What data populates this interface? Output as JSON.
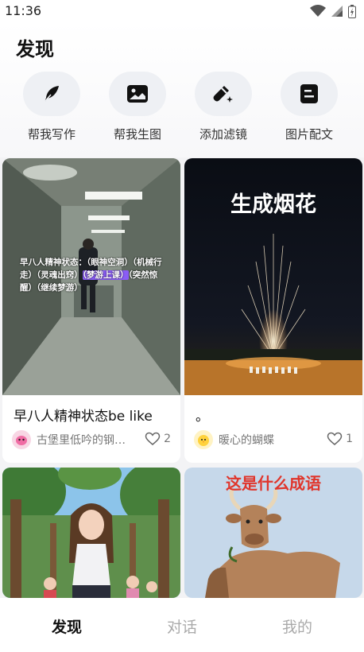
{
  "status": {
    "time": "11:36"
  },
  "header": {
    "title": "发现"
  },
  "tools": [
    {
      "label": "帮我写作",
      "icon": "feather-pen-icon"
    },
    {
      "label": "帮我生图",
      "icon": "image-icon"
    },
    {
      "label": "添加滤镜",
      "icon": "magic-wand-icon"
    },
    {
      "label": "图片配文",
      "icon": "note-icon"
    }
  ],
  "feed": [
    {
      "title": "早八人精神状态be like",
      "author": "古堡里低吟的钢…",
      "likes": "2",
      "overlay_text": "早八人精神状态：（眼神空洞）（机械行走）（灵魂出窍）",
      "overlay_highlight": "（梦游上课）",
      "overlay_tail": "（突然惊醒）（继续梦游）"
    },
    {
      "title": "。",
      "author": "暖心的蝴蝶",
      "likes": "1",
      "overlay_text": "生成烟花"
    },
    {
      "title": "",
      "author": "",
      "likes": ""
    },
    {
      "title": "",
      "author": "",
      "likes": "",
      "overlay_text": "这是什么成语"
    }
  ],
  "tabs": [
    {
      "label": "发现",
      "active": true
    },
    {
      "label": "对话",
      "active": false
    },
    {
      "label": "我的",
      "active": false
    }
  ],
  "colors": {
    "accent": "#111111",
    "inactive_tab": "#aaaaaa",
    "highlight": "#8a5cf6"
  }
}
